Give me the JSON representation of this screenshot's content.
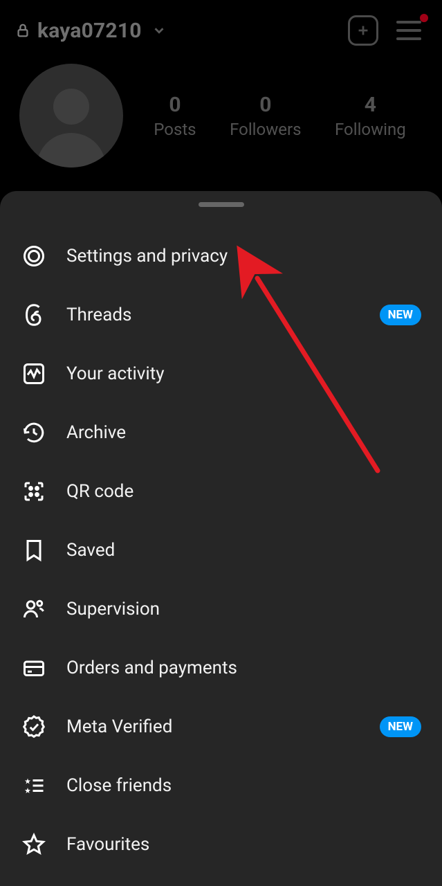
{
  "header": {
    "username": "kaya07210"
  },
  "stats": {
    "posts": {
      "value": "0",
      "label": "Posts"
    },
    "followers": {
      "value": "0",
      "label": "Followers"
    },
    "following": {
      "value": "4",
      "label": "Following"
    }
  },
  "menu": {
    "settings": {
      "label": "Settings and privacy"
    },
    "threads": {
      "label": "Threads",
      "badge": "NEW"
    },
    "activity": {
      "label": "Your activity"
    },
    "archive": {
      "label": "Archive"
    },
    "qr": {
      "label": "QR code"
    },
    "saved": {
      "label": "Saved"
    },
    "supervision": {
      "label": "Supervision"
    },
    "orders": {
      "label": "Orders and payments"
    },
    "meta_verified": {
      "label": "Meta Verified",
      "badge": "NEW"
    },
    "close_friends": {
      "label": "Close friends"
    },
    "favourites": {
      "label": "Favourites"
    }
  }
}
